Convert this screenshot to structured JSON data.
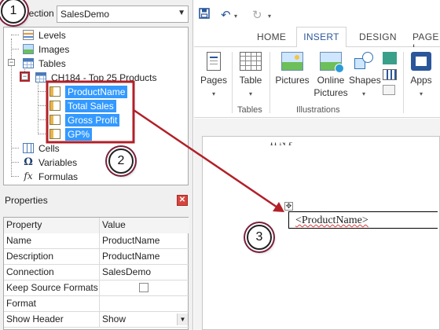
{
  "connection": {
    "label": "nection",
    "value": "SalesDemo"
  },
  "tree": {
    "items": [
      {
        "label": "Levels",
        "icon": "levels-icon"
      },
      {
        "label": "Images",
        "icon": "images-icon"
      },
      {
        "label": "Tables",
        "icon": "tables-icon"
      },
      {
        "label": "CH184 - Top 25 Products",
        "icon": "table-icon"
      },
      {
        "label": "ProductName",
        "icon": "field-icon"
      },
      {
        "label": "Total Sales",
        "icon": "field-icon"
      },
      {
        "label": "Gross Profit",
        "icon": "field-icon"
      },
      {
        "label": "GP%",
        "icon": "field-icon"
      },
      {
        "label": "Cells",
        "icon": "cells-icon"
      },
      {
        "label": "Variables",
        "icon": "omega-icon",
        "glyph": "Ω"
      },
      {
        "label": "Formulas",
        "icon": "fx-icon",
        "glyph": "fx"
      }
    ]
  },
  "properties": {
    "title": "Properties",
    "headers": {
      "property": "Property",
      "value": "Value"
    },
    "rows": [
      {
        "name": "Name",
        "value": "ProductName"
      },
      {
        "name": "Description",
        "value": "ProductName"
      },
      {
        "name": "Connection",
        "value": "SalesDemo"
      },
      {
        "name": "Keep Source Formats",
        "value": ""
      },
      {
        "name": "Format",
        "value": ""
      },
      {
        "name": "Show Header",
        "value": "Show"
      }
    ]
  },
  "word": {
    "tabs": [
      "HOME",
      "INSERT",
      "DESIGN",
      "PAGE L"
    ],
    "ribbon": {
      "pages": "Pages",
      "table": "Table",
      "pictures": "Pictures",
      "online_pictures_1": "Online",
      "online_pictures_2": "Pictures",
      "shapes": "Shapes",
      "apps": "Apps",
      "group_tables": "Tables",
      "group_illustrations": "Illustrations"
    },
    "doc_cell_text": "<ProductName>",
    "cut_text": "Ti    N    P"
  },
  "callouts": [
    "1",
    "2",
    "3"
  ],
  "colors": {
    "selection": "#3399ff",
    "annotation": "#b22028",
    "word_blue": "#2b579a"
  }
}
